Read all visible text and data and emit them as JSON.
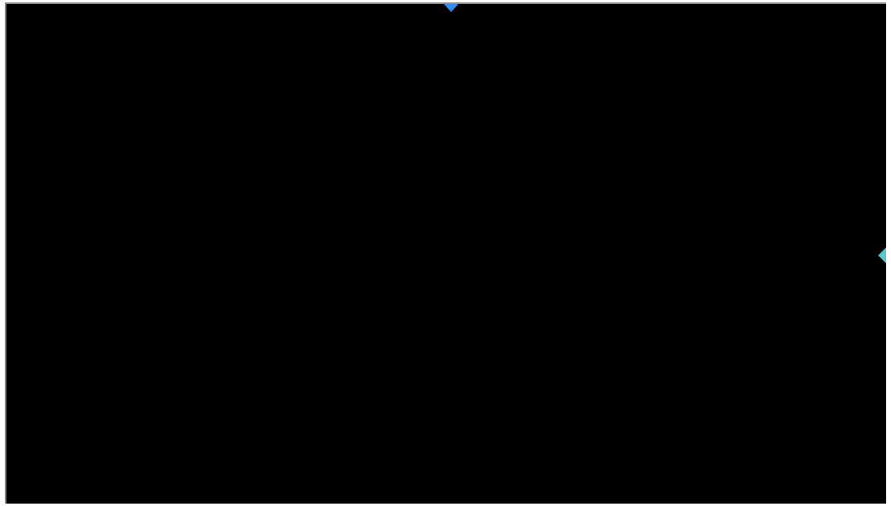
{
  "display": {
    "markers": [
      {
        "kind": "top",
        "color": "#2f8cf0"
      },
      {
        "kind": "right",
        "color": "#5ec8c8"
      }
    ]
  }
}
